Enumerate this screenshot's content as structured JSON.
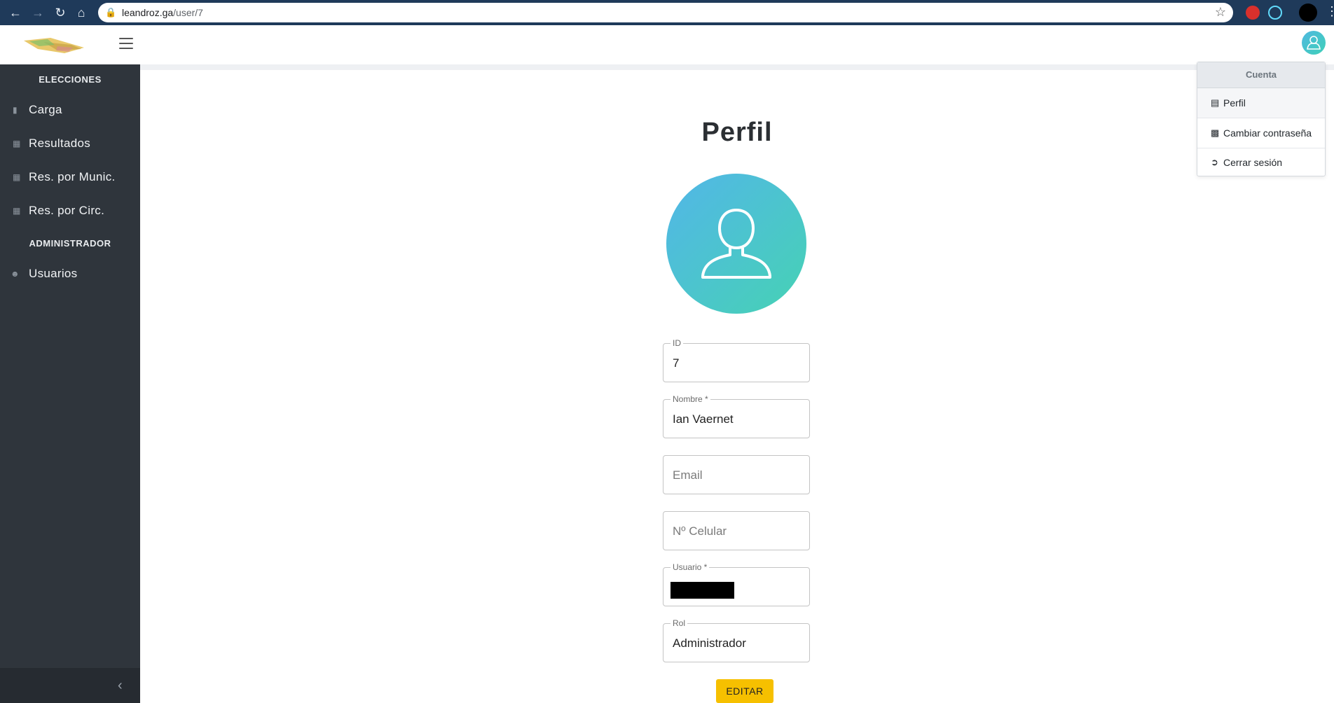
{
  "browser": {
    "url_host": "leandroz.ga",
    "url_path": "/user/7"
  },
  "sidebar": {
    "section_elecciones": "ELECCIONES",
    "items": [
      {
        "label": "Carga",
        "icon": "file-icon"
      },
      {
        "label": "Resultados",
        "icon": "bar-chart-icon"
      },
      {
        "label": "Res. por Munic.",
        "icon": "bar-chart-icon"
      },
      {
        "label": "Res. por Circ.",
        "icon": "bar-chart-icon"
      }
    ],
    "section_admin": "ADMINISTRADOR",
    "admin_items": [
      {
        "label": "Usuarios",
        "icon": "users-icon"
      }
    ]
  },
  "main": {
    "title": "Perfil",
    "fields": {
      "id": {
        "label": "ID",
        "value": "7"
      },
      "nombre": {
        "label": "Nombre *",
        "value": "Ian Vaernet"
      },
      "email": {
        "placeholder": "Email"
      },
      "celular": {
        "placeholder": "Nº Celular"
      },
      "usuario": {
        "label": "Usuario *"
      },
      "rol": {
        "label": "Rol",
        "value": "Administrador"
      }
    },
    "edit_button": "EDITAR"
  },
  "account_menu": {
    "header": "Cuenta",
    "items": [
      {
        "label": "Perfil",
        "icon": "id-card-icon"
      },
      {
        "label": "Cambiar contraseña",
        "icon": "lock-icon"
      },
      {
        "label": "Cerrar sesión",
        "icon": "sign-out-icon"
      }
    ]
  },
  "colors": {
    "sidebar_bg": "#2f353c",
    "accent_gradient_start": "#52b6e8",
    "accent_gradient_end": "#46d2b4",
    "button_yellow": "#f6c000"
  }
}
